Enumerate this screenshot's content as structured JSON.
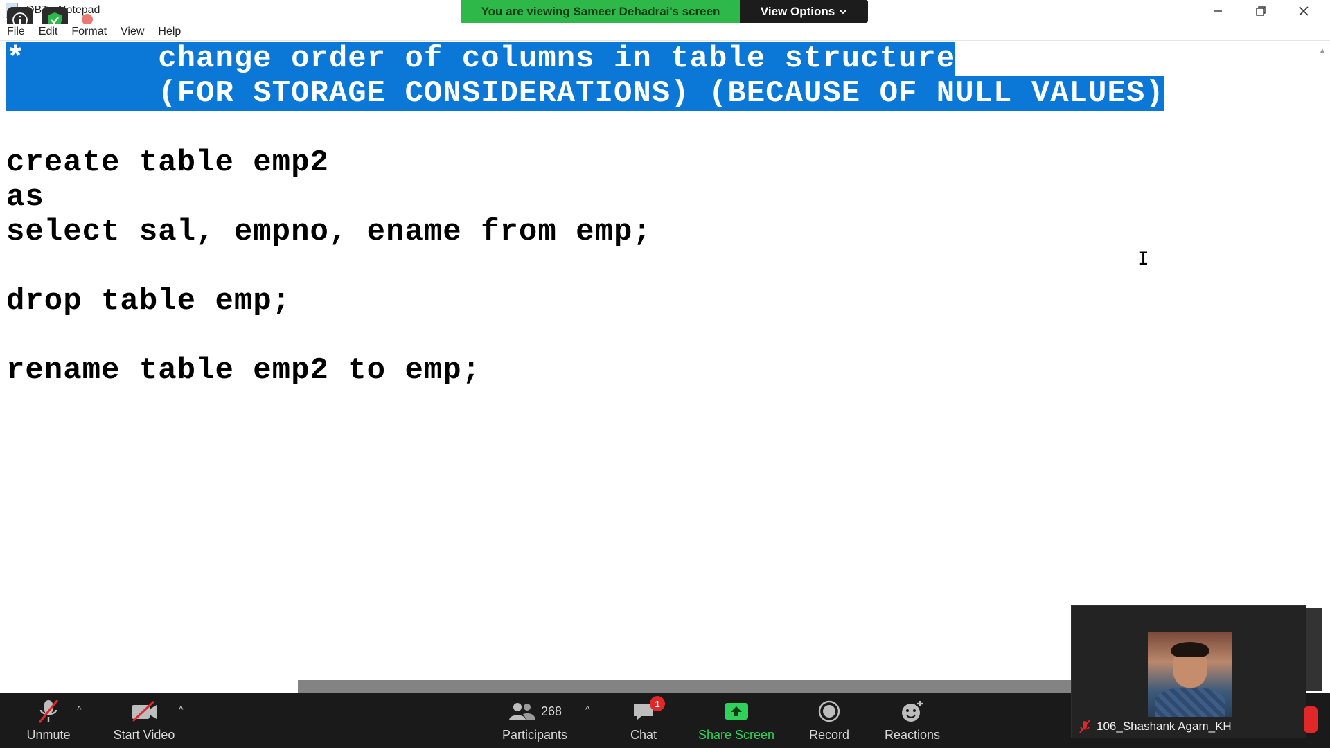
{
  "window": {
    "title": "DBT - Notepad",
    "controls": [
      "minimize",
      "restore",
      "close"
    ]
  },
  "banner": {
    "viewing_text": "You are viewing Sameer Dehadrai's screen",
    "view_options_label": "View Options"
  },
  "menu": [
    "File",
    "Edit",
    "Format",
    "View",
    "Help"
  ],
  "editor": {
    "selected_lines": [
      "*       change order of columns in table structure",
      "        (FOR STORAGE CONSIDERATIONS) (BECAUSE OF NULL VALUES)"
    ],
    "lines": [
      "create table emp2",
      "as",
      "select sal, empno, ename from emp;",
      "",
      "drop table emp;",
      "",
      "rename table emp2 to emp;"
    ]
  },
  "toolbar": {
    "unmute_label": "Unmute",
    "start_video_label": "Start Video",
    "participants_label": "Participants",
    "participants_count": "268",
    "chat_label": "Chat",
    "chat_badge": "1",
    "share_screen_label": "Share Screen",
    "record_label": "Record",
    "reactions_label": "Reactions"
  },
  "self_view": {
    "name": "106_Shashank Agam_KH"
  },
  "colors": {
    "selection": "#0b78d7",
    "banner_green": "#2fb84a",
    "toolbar_bg": "#1a1a1a",
    "share_green": "#2fd15a",
    "badge_red": "#e02828"
  }
}
